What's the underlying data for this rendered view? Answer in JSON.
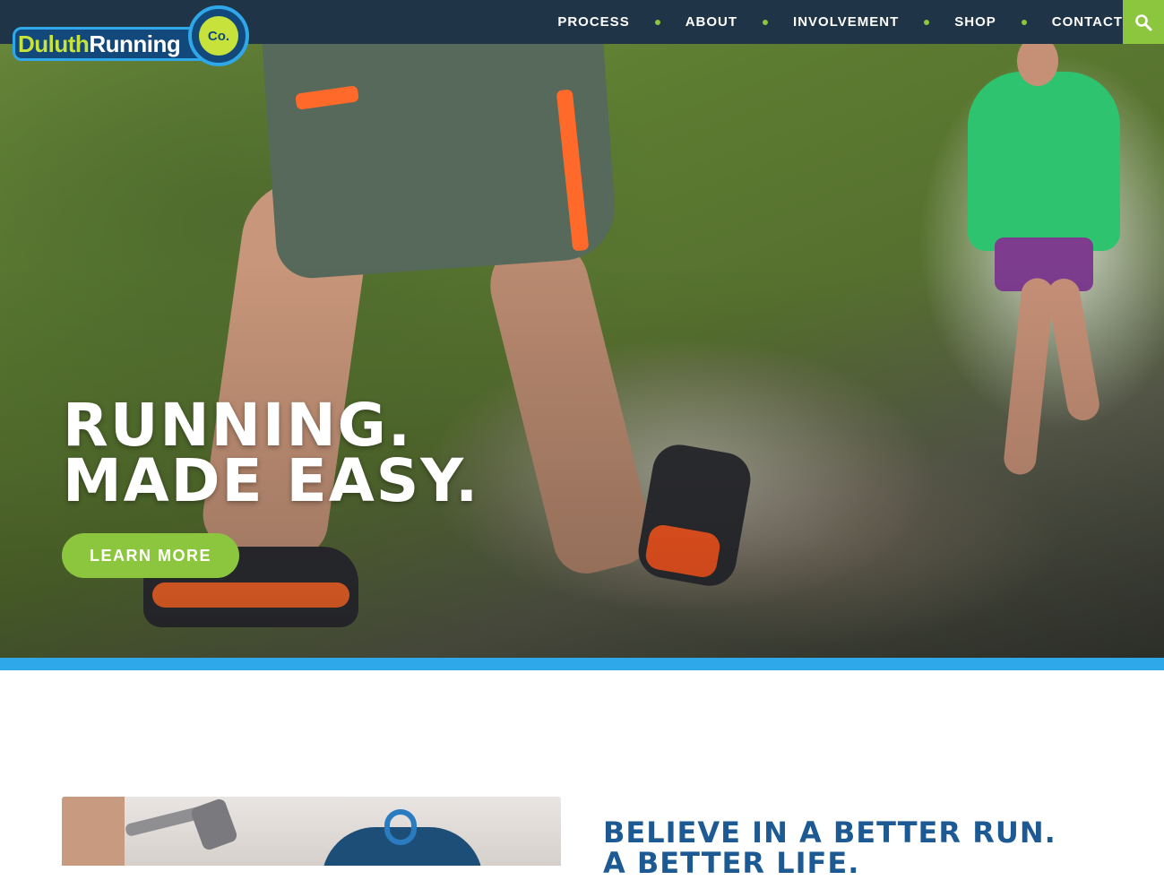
{
  "brand": {
    "logo_name": "DuluthRunning",
    "logo_word_part1": "Duluth",
    "logo_word_part2": "Running",
    "logo_badge": "Co."
  },
  "nav": {
    "items": [
      {
        "label": "PROCESS"
      },
      {
        "label": "ABOUT"
      },
      {
        "label": "INVOLVEMENT"
      },
      {
        "label": "SHOP"
      },
      {
        "label": "CONTACT"
      }
    ],
    "search_icon": "search-icon"
  },
  "hero": {
    "headline_line1": "RUNNING.",
    "headline_line2": "MADE EASY.",
    "cta_label": "LEARN MORE"
  },
  "section": {
    "heading_line1": "BELIEVE IN A BETTER RUN.",
    "heading_line2": "A BETTER LIFE."
  },
  "colors": {
    "nav_bg": "#1f3447",
    "accent_green": "#8cc63f",
    "accent_blue": "#2ea8e8",
    "heading_blue": "#1d5a93"
  }
}
